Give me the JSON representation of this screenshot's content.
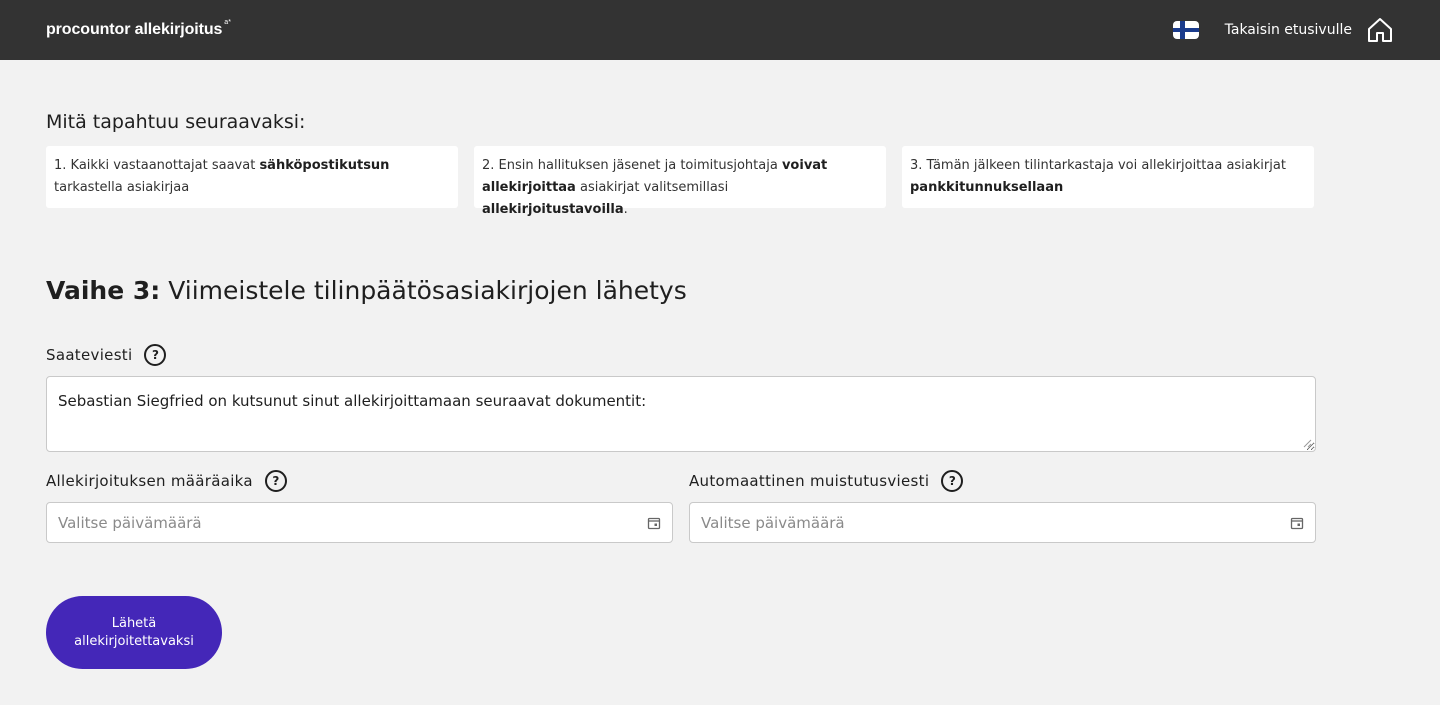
{
  "header": {
    "brand": "procountor allekirjoitus",
    "brand_sup": "a*",
    "language_flag_icon": "finland-flag-icon",
    "home_link_label": "Takaisin etusivulle",
    "home_icon": "home-icon"
  },
  "next_steps": {
    "title": "Mitä tapahtuu seuraavaksi:",
    "cards": [
      {
        "text_1": "1. Kaikki vastaanottajat saavat ",
        "bold_1": "sähköpostikutsun",
        "text_2": "tarkastella asiakirjaa"
      },
      {
        "text_1": "2. Ensin hallituksen jäsenet ja toimitusjohtaja ",
        "bold_1": "voivat",
        "bold_2": "allekirjoittaa",
        "text_2": " asiakirjat valitsemillasi ",
        "bold_3": "allekirjoitustavoilla",
        "text_3": "."
      },
      {
        "text_1": "3. Tämän jälkeen tilintarkastaja voi allekirjoittaa asiakirjat",
        "bold_1": "pankkitunnuksellaan"
      }
    ]
  },
  "step": {
    "prefix": "Vaihe 3:",
    "title": " Viimeistele tilinpäätösasiakirjojen lähetys"
  },
  "form": {
    "message_label": "Saateviesti",
    "message_value": "Sebastian Siegfried on kutsunut sinut allekirjoittamaan seuraavat dokumentit:",
    "deadline_label": "Allekirjoituksen määräaika",
    "deadline_placeholder": "Valitse päivämäärä",
    "reminder_label": "Automaattinen muistutusviesti",
    "reminder_placeholder": "Valitse päivämäärä",
    "help_glyph": "?"
  },
  "submit": {
    "line_1": "Lähetä",
    "line_2": "allekirjoitettavaksi"
  },
  "colors": {
    "topbar": "#333333",
    "background": "#f2f2f2",
    "primary_button": "#4427b8",
    "flag_blue": "#1a3b8c"
  }
}
